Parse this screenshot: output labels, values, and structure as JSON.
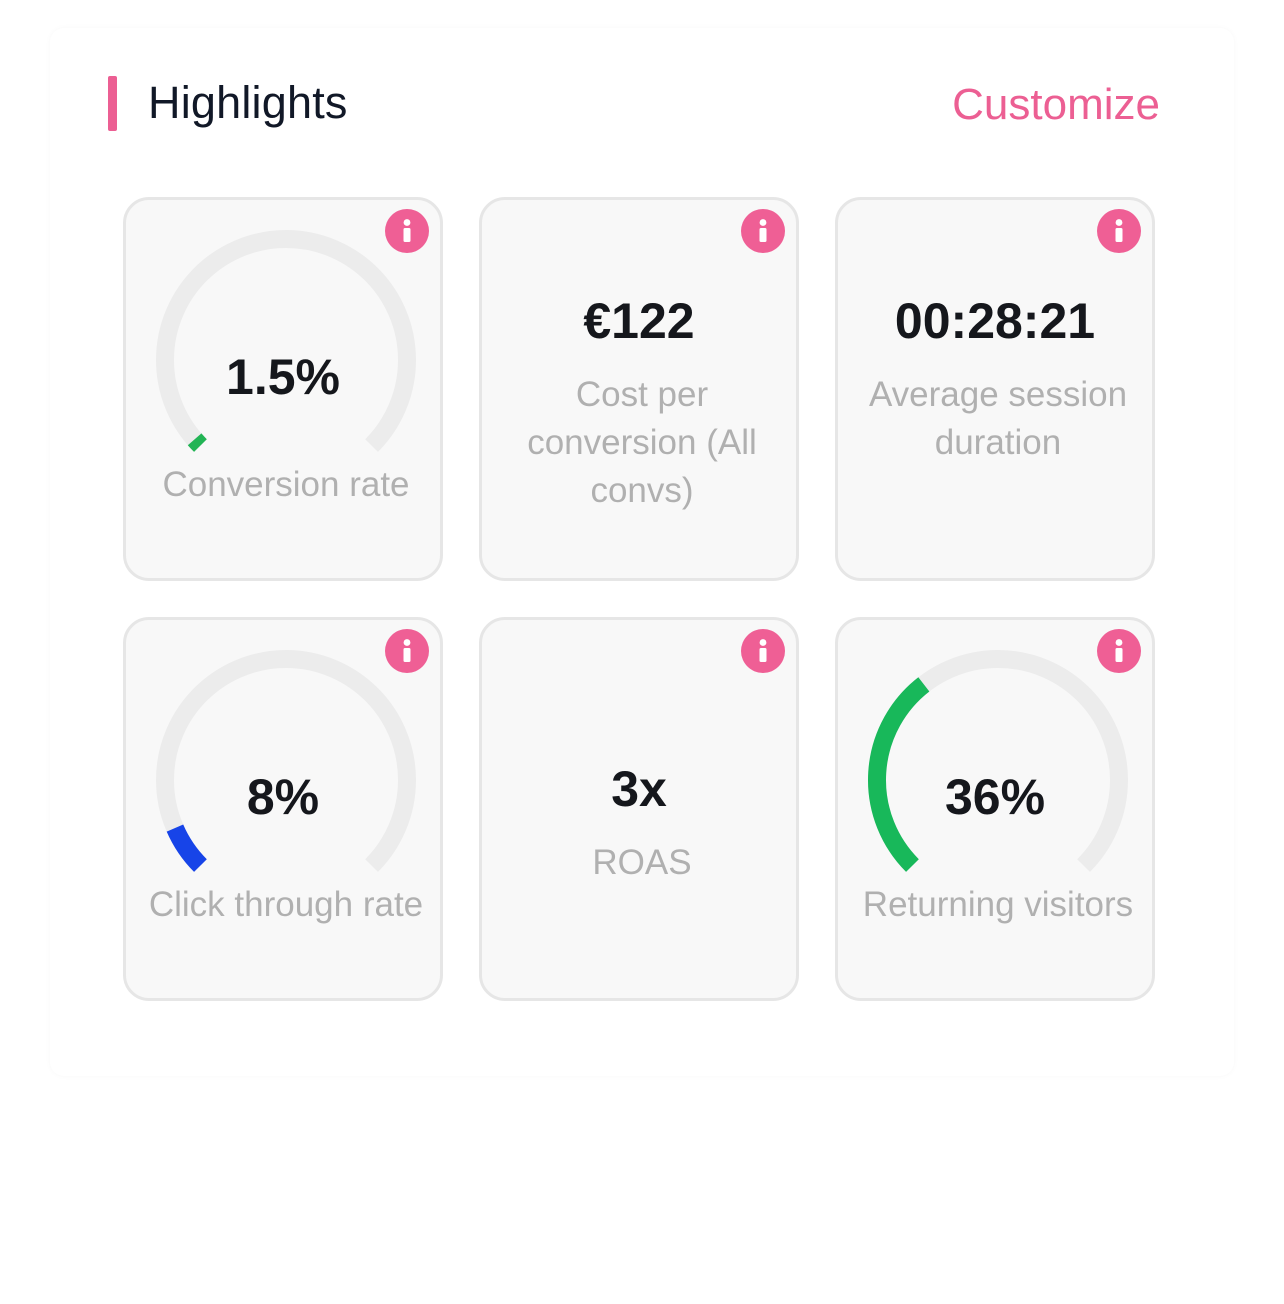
{
  "header": {
    "title": "Highlights",
    "customize_label": "Customize",
    "accent_color": "#ec5f93"
  },
  "info_icon": "info-icon",
  "cards": [
    {
      "value": "1.5%",
      "label": "Conversion rate",
      "gauge": true,
      "fraction": 0.015,
      "color": "#22b455"
    },
    {
      "value": "€122",
      "label": "Cost per conversion (All convs)",
      "gauge": false
    },
    {
      "value": "00:28:21",
      "label": "Average session duration",
      "gauge": false
    },
    {
      "value": "8%",
      "label": "Click through rate",
      "gauge": true,
      "fraction": 0.08,
      "color": "#1744e8"
    },
    {
      "value": "3x",
      "label": "ROAS",
      "gauge": false
    },
    {
      "value": "36%",
      "label": "Returning visitors",
      "gauge": true,
      "fraction": 0.36,
      "color": "#18b85a"
    }
  ]
}
